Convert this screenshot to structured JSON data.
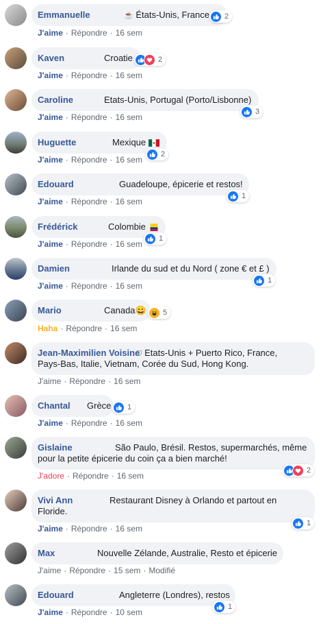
{
  "comments": [
    {
      "author": "Emmanuelle",
      "prefix": "☕",
      "text": "États-Unis, France",
      "reaction_count": "2",
      "like": "J'aime",
      "reply": "Répondre",
      "time": "16 sem"
    },
    {
      "author": "Kaven",
      "text": "Croatie",
      "reaction_count": "2",
      "like": "J'aime",
      "reply": "Répondre",
      "time": "16 sem"
    },
    {
      "author": "Caroline",
      "text": "Etats-Unis, Portugal (Porto/Lisbonne)",
      "reaction_count": "3",
      "like": "J'aime",
      "reply": "Répondre",
      "time": "16 sem"
    },
    {
      "author": "Huguette",
      "text": "Mexique",
      "reaction_count": "2",
      "like": "J'aime",
      "reply": "Répondre",
      "time": "16 sem"
    },
    {
      "author": "Edouard",
      "text": "Guadeloupe, épicerie et restos!",
      "reaction_count": "1",
      "like": "J'aime",
      "reply": "Répondre",
      "time": "16 sem"
    },
    {
      "author": "Frédérick",
      "text": "Colombie",
      "reaction_count": "1",
      "like": "J'aime",
      "reply": "Répondre",
      "time": "16 sem"
    },
    {
      "author": "Damien",
      "text": "Irlande du sud et du Nord ( zone € et £ )",
      "reaction_count": "1",
      "like": "J'aime",
      "reply": "Répondre",
      "time": "16 sem"
    },
    {
      "author": "Mario",
      "text": "Canada😀",
      "reaction_count": "5",
      "like": "Haha",
      "reply": "Répondre",
      "time": "16 sem"
    },
    {
      "author": "Jean-Maximilien Voisine",
      "text_line1": "Etats-Unis + Puerto Rico, France,",
      "text_line2": "Pays-Bas, Italie, Vietnam, Corée du Sud, Hong Kong.",
      "like": "J'aime",
      "reply": "Répondre",
      "time": "16 sem"
    },
    {
      "author": "Chantal",
      "text": "Grèce",
      "reaction_count": "1",
      "like": "J'aime",
      "reply": "Répondre",
      "time": "16 sem"
    },
    {
      "author": "Gislaine",
      "text_line1": "São Paulo, Brésil. Restos, supermarchés, même",
      "text_line2": "pour la petite épicerie du coin ça a bien marché!",
      "reaction_count": "2",
      "like": "J'adore",
      "reply": "Répondre",
      "time": "16 sem"
    },
    {
      "author": "Vivi Ann",
      "text_line1": "Restaurant Disney à Orlando et partout en",
      "text_line2": "Floride.",
      "reaction_count": "1",
      "like": "J'aime",
      "reply": "Répondre",
      "time": "16 sem"
    },
    {
      "author": "Max",
      "text": "Nouvelle Zélande, Australie, Resto et épicerie",
      "like": "J'aime",
      "reply": "Répondre",
      "time": "15 sem",
      "edited": "Modifié"
    },
    {
      "author": "Edouard",
      "text": "Angleterre (Londres), restos",
      "reaction_count": "1",
      "like": "J'aime",
      "reply": "Répondre",
      "time": "10 sem"
    }
  ],
  "colors": {
    "bubble": "#f0f2f5",
    "author": "#385898",
    "meta": "#606770",
    "like": "#1877f2",
    "love": "#f33e58",
    "haha": "#f7b125"
  }
}
